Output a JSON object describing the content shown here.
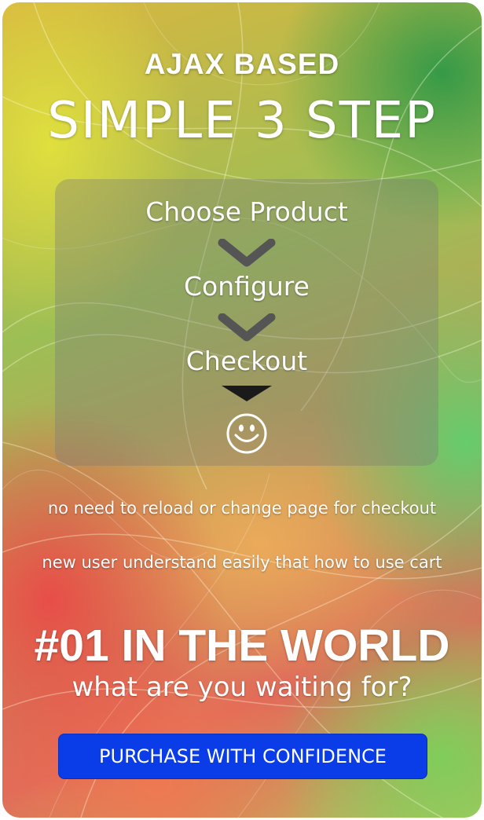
{
  "header": {
    "kicker": "AJAX BASED",
    "title": "SIMPLE 3 STEP"
  },
  "steps": [
    {
      "label": "Choose Product",
      "connector_icon": "chevron-down-icon"
    },
    {
      "label": "Configure",
      "connector_icon": "chevron-down-icon"
    },
    {
      "label": "Checkout",
      "connector_icon": "triangle-down-icon"
    }
  ],
  "result_icon": "smiley-icon",
  "features": [
    "no need to reload or change page for checkout",
    "new user understand easily that how to use cart"
  ],
  "promo": {
    "headline": "#01 IN THE WORLD",
    "subline": "what are you waiting for?"
  },
  "cta": {
    "label": "PURCHASE WITH CONFIDENCE",
    "color": "#0a3de8"
  }
}
